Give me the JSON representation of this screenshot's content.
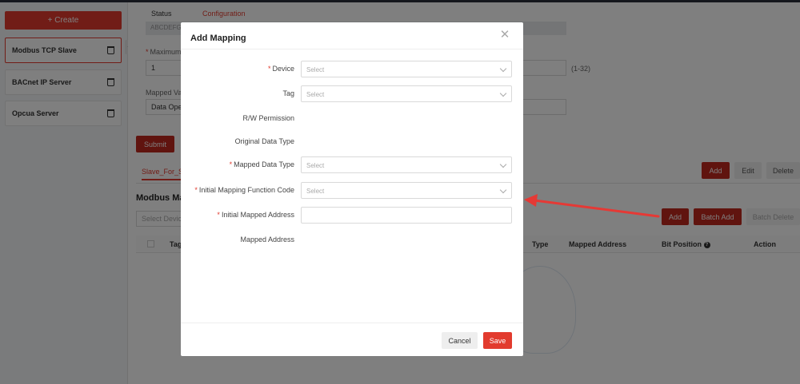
{
  "sidebar": {
    "create_label": "+ Create",
    "items": [
      {
        "label": "Modbus TCP Slave",
        "active": true
      },
      {
        "label": "BACnet IP Server",
        "active": false
      },
      {
        "label": "Opcua Server",
        "active": false
      }
    ]
  },
  "background": {
    "tabs": [
      "Status",
      "Configuration"
    ],
    "readonly_value": "ABCDEFG",
    "maximum_label": "Maximum",
    "maximum_value": "1",
    "range_hint": "(1-32)",
    "mapped_label": "Mapped Va",
    "mapped_value": "Data Ope",
    "submit_label": "Submit",
    "slave_tab": "Slave_For_S",
    "section_title": "Modbus Ma",
    "select_device_placeholder": "Select Devic",
    "toolbar_top": [
      "Add",
      "Edit",
      "Delete"
    ],
    "toolbar_bottom": [
      "Add",
      "Batch Add",
      "Batch Delete"
    ],
    "table_headers": [
      "Tag",
      "Type",
      "Mapped Address",
      "Bit Position",
      "Action"
    ]
  },
  "modal": {
    "title": "Add Mapping",
    "fields": [
      {
        "label": "Device",
        "required": true,
        "kind": "select",
        "placeholder": "Select"
      },
      {
        "label": "Tag",
        "required": false,
        "kind": "select",
        "placeholder": "Select"
      },
      {
        "label": "R/W Permission",
        "required": false,
        "kind": "text"
      },
      {
        "label": "Original Data Type",
        "required": false,
        "kind": "text"
      },
      {
        "label": "Mapped Data Type",
        "required": true,
        "kind": "select",
        "placeholder": "Select"
      },
      {
        "label": "Initial Mapping Function Code",
        "required": true,
        "kind": "select",
        "placeholder": "Select"
      },
      {
        "label": "Initial Mapped Address",
        "required": true,
        "kind": "input",
        "value": ""
      },
      {
        "label": "Mapped Address",
        "required": false,
        "kind": "text"
      }
    ],
    "cancel_label": "Cancel",
    "save_label": "Save"
  },
  "colors": {
    "accent": "#e23b2e",
    "annotation_arrow": "#e53935"
  }
}
